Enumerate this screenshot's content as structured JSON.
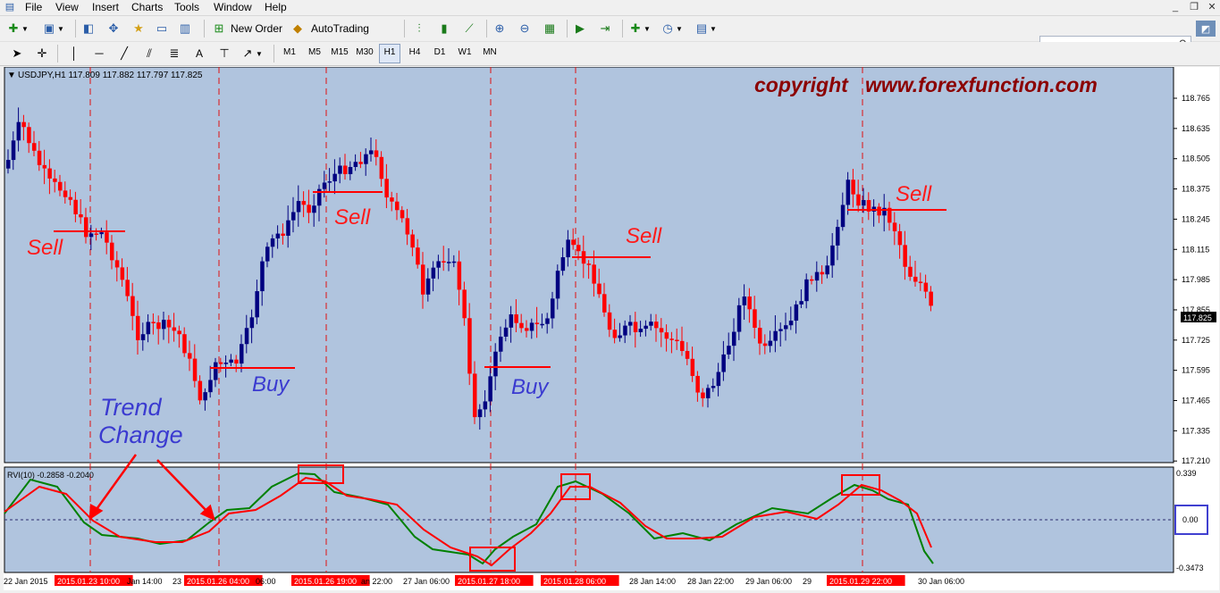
{
  "menu": {
    "items": [
      "File",
      "View",
      "Insert",
      "Charts",
      "Tools",
      "Window",
      "Help"
    ],
    "controls": [
      "_",
      "❐",
      "✕"
    ]
  },
  "toolbar": {
    "new_order": "New Order",
    "autotrading": "AutoTrading",
    "timeframes": [
      "M1",
      "M5",
      "M15",
      "M30",
      "H1",
      "H4",
      "D1",
      "W1",
      "MN"
    ],
    "active_timeframe": "H1",
    "search_value": ""
  },
  "chart": {
    "header": "USDJPY,H1  117.809 117.882 117.797 117.825",
    "watermark": "copyright   www.forexfunction.com",
    "price_labels": [
      "118.765",
      "118.635",
      "118.505",
      "118.375",
      "118.245",
      "118.115",
      "117.985",
      "117.855",
      "117.725",
      "117.595",
      "117.465",
      "117.335",
      "117.210"
    ],
    "current_price": "117.825",
    "indicator_header": "RVI(10) -0.2858 -0.2040",
    "indicator_labels": [
      "0.339",
      "0.00",
      "-0.3473"
    ],
    "time_labels": [
      {
        "text": "22 Jan 2015",
        "hl": false
      },
      {
        "text": "2015.01.23 10:00",
        "hl": true
      },
      {
        "text": "Jan 14:00",
        "hl": false
      },
      {
        "text": "23",
        "hl": false
      },
      {
        "text": "2015.01.26 04:00",
        "hl": true
      },
      {
        "text": "06:00",
        "hl": false
      },
      {
        "text": "2015.01.26 19:00",
        "hl": true
      },
      {
        "text": "an 22:00",
        "hl": false
      },
      {
        "text": "27 Jan 06:00",
        "hl": false
      },
      {
        "text": "2015.01.27 18:00",
        "hl": true
      },
      {
        "text": "2015.01.28 06:00",
        "hl": true
      },
      {
        "text": "28 Jan 14:00",
        "hl": false
      },
      {
        "text": "28 Jan 22:00",
        "hl": false
      },
      {
        "text": "29 Jan 06:00",
        "hl": false
      },
      {
        "text": "29",
        "hl": false
      },
      {
        "text": "2015.01.29 22:00",
        "hl": true
      },
      {
        "text": "30 Jan 06:00",
        "hl": false
      }
    ],
    "annotations": {
      "sell": "Sell",
      "buy": "Buy",
      "trend": "Trend",
      "change": "Change"
    },
    "colors": {
      "bg": "#b0c4de",
      "bull": "#000080",
      "bear": "#ff0000",
      "rvi_main": "#008000",
      "rvi_signal": "#ff0000",
      "watermark": "#8b0000",
      "trend_text": "#3a3ad0"
    }
  }
}
